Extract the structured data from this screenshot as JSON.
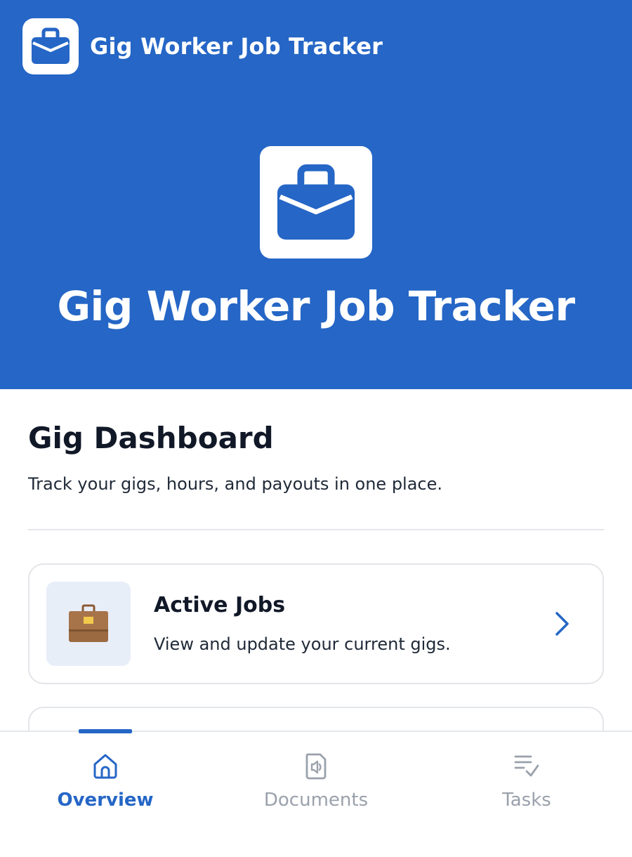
{
  "app": {
    "title": "Gig Worker Job Tracker",
    "icon": "briefcase-icon"
  },
  "hero": {
    "title": "Gig Worker Job Tracker",
    "icon": "briefcase-icon"
  },
  "dashboard": {
    "heading": "Gig Dashboard",
    "subtitle": "Track your gigs, hours, and payouts in one place."
  },
  "cards": [
    {
      "title": "Active Jobs",
      "description": "View and update your current gigs.",
      "icon": "briefcase-icon",
      "action_icon": "chevron-right-icon"
    }
  ],
  "bottom_nav": {
    "items": [
      {
        "label": "Overview",
        "icon": "home-icon",
        "active": true
      },
      {
        "label": "Documents",
        "icon": "document-icon",
        "active": false
      },
      {
        "label": "Tasks",
        "icon": "tasks-checklist-icon",
        "active": false
      }
    ]
  },
  "colors": {
    "brand": "#2566C6",
    "inactive": "#9aa1ab",
    "card_border": "#e3e5e9"
  }
}
